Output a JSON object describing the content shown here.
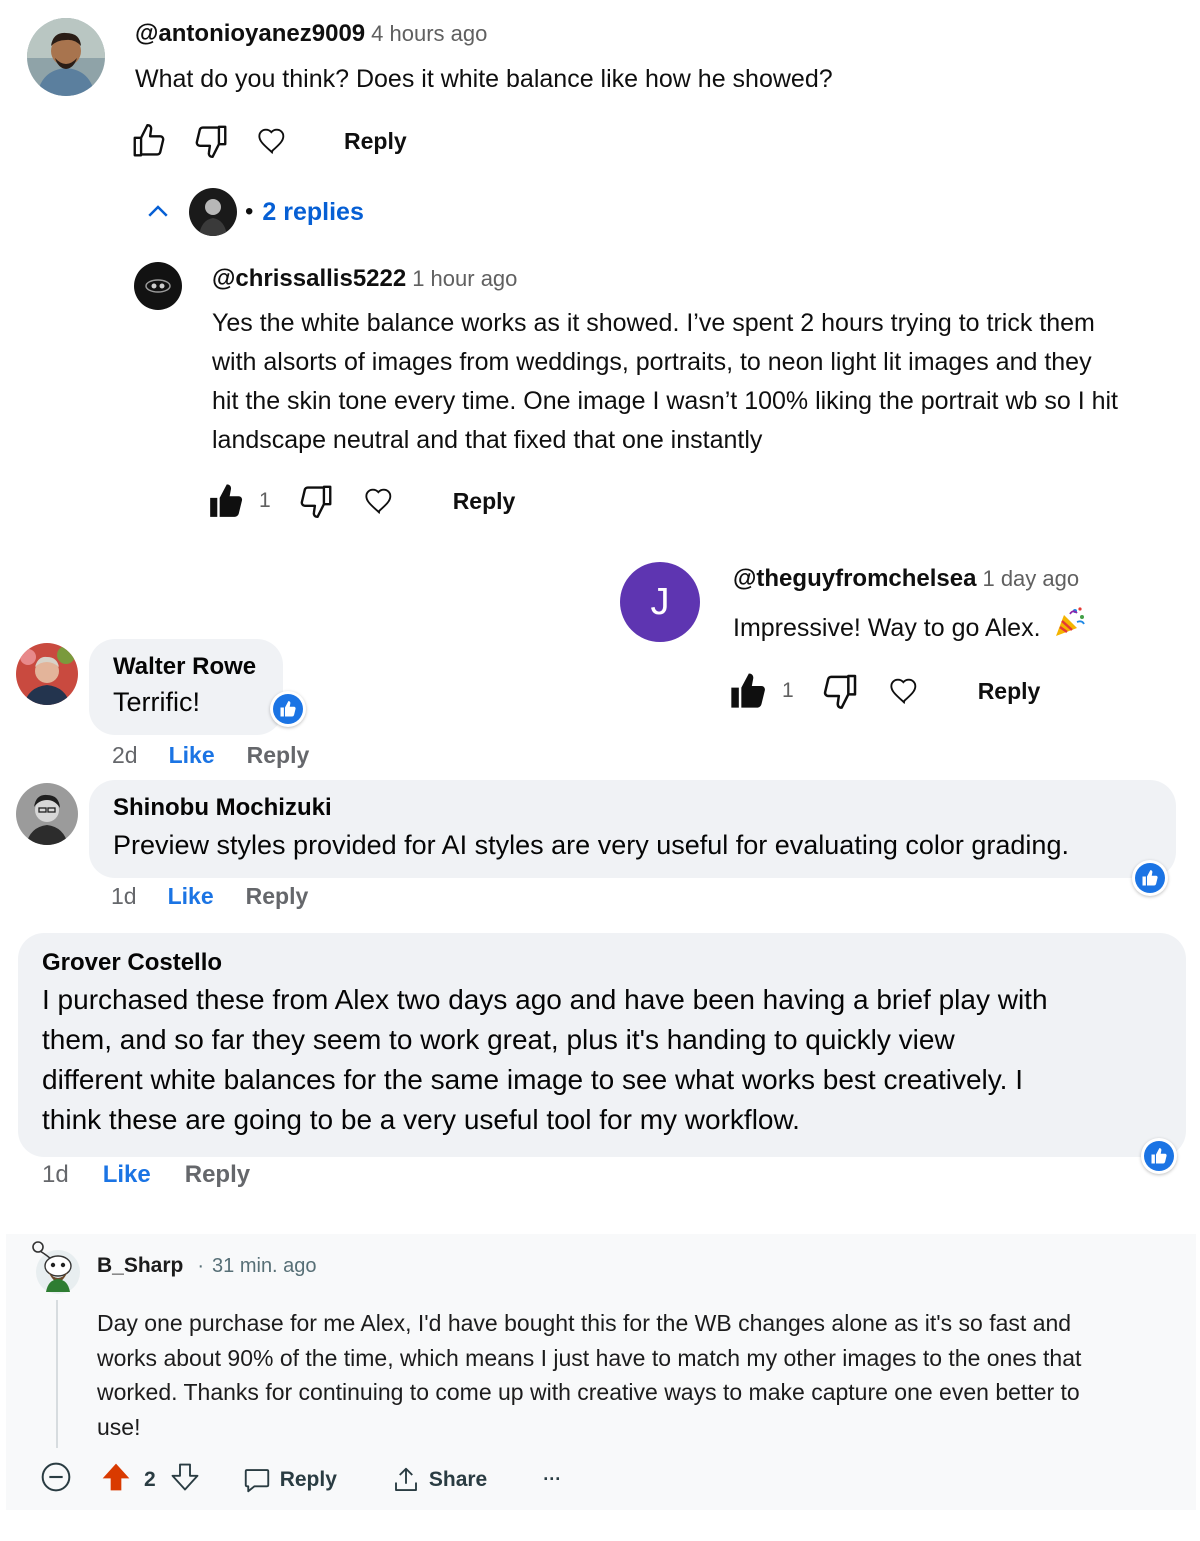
{
  "yt_comment": {
    "author": "@antonioyanez9009",
    "time": "4 hours ago",
    "text": "What do you think? Does it white balance like how he showed?",
    "reply_label": "Reply",
    "replies_toggle": "2 replies",
    "bullet": "•"
  },
  "yt_reply": {
    "author": "@chrissallis5222",
    "time": "1 hour ago",
    "lines": [
      "Yes the white balance works as it showed. I’ve spent 2 hours trying to trick them",
      "with alsorts of images from weddings, portraits, to neon light lit images and they",
      "hit the skin tone every time. One image I wasn’t 100% liking the portrait wb so I hit",
      "landscape neutral and that fixed that one instantly"
    ],
    "likes": "1",
    "reply_label": "Reply"
  },
  "yt_chelsea": {
    "avatar_letter": "J",
    "author": "@theguyfromchelsea",
    "time": "1 day ago",
    "text": "Impressive! Way to go Alex.",
    "likes": "1",
    "reply_label": "Reply"
  },
  "fb_walter": {
    "name": "Walter Rowe",
    "text": "Terrific!",
    "age": "2d",
    "like_label": "Like",
    "reply_label": "Reply"
  },
  "fb_shinobu": {
    "name": "Shinobu Mochizuki",
    "text": "Preview styles provided for AI styles are very useful for evaluating color grading.",
    "age": "1d",
    "like_label": "Like",
    "reply_label": "Reply"
  },
  "fb_grover": {
    "name": "Grover Costello",
    "lines": [
      "I purchased these from Alex two days ago and have been having a brief play with",
      "them, and so far they seem to work great, plus it's handing to quickly view",
      "different white balances for the same image to see what works best creatively. I",
      "think these are going to be a very useful tool for my workflow."
    ],
    "age": "1d",
    "like_label": "Like",
    "reply_label": "Reply"
  },
  "reddit": {
    "author": "B_Sharp",
    "separator": "·",
    "time": "31 min. ago",
    "lines": [
      "Day one purchase for me Alex, I'd have bought this for the WB changes alone as it's so fast and",
      "works about 90% of the time, which means I just have to match my other images to the ones that",
      "worked. Thanks for continuing to come up with creative ways to make capture one even better to",
      "use!"
    ],
    "score": "2",
    "reply_label": "Reply",
    "share_label": "Share",
    "more_label": "···"
  },
  "colors": {
    "yt_link_blue": "#065fd4",
    "fb_blue": "#1b74e4",
    "fb_bubble": "#f0f2f5",
    "reddit_upvote": "#d93a00",
    "reddit_card": "#f8f9fa",
    "avatar_purple": "#5e35b1"
  }
}
